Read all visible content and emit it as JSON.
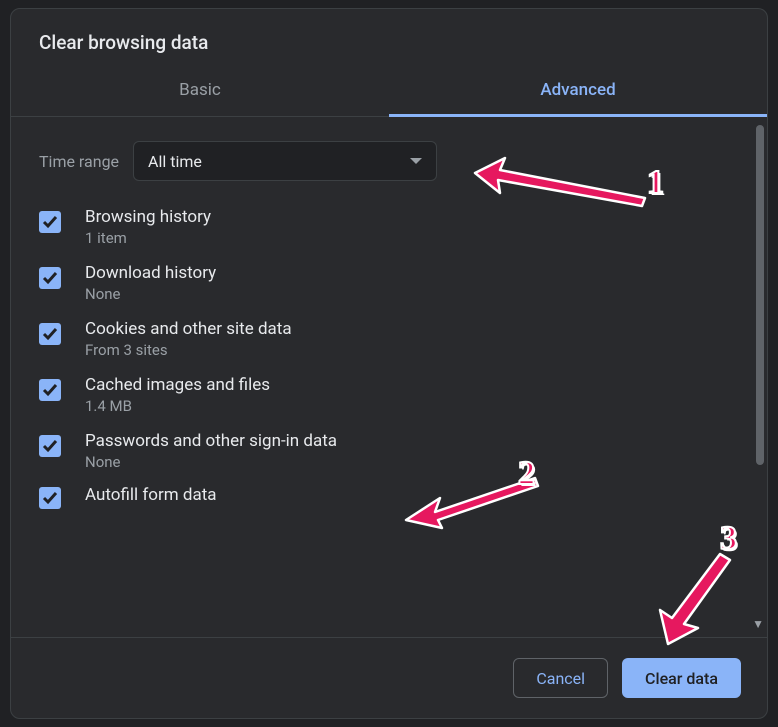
{
  "title": "Clear browsing data",
  "tabs": {
    "basic": "Basic",
    "advanced": "Advanced"
  },
  "time": {
    "label": "Time range",
    "value": "All time"
  },
  "items": [
    {
      "label": "Browsing history",
      "sub": "1 item"
    },
    {
      "label": "Download history",
      "sub": "None"
    },
    {
      "label": "Cookies and other site data",
      "sub": "From 3 sites"
    },
    {
      "label": "Cached images and files",
      "sub": "1.4 MB"
    },
    {
      "label": "Passwords and other sign-in data",
      "sub": "None"
    },
    {
      "label": "Autofill form data",
      "sub": ""
    }
  ],
  "buttons": {
    "cancel": "Cancel",
    "clear": "Clear data"
  },
  "annotations": {
    "n1": "1",
    "n2": "2",
    "n3": "3"
  }
}
